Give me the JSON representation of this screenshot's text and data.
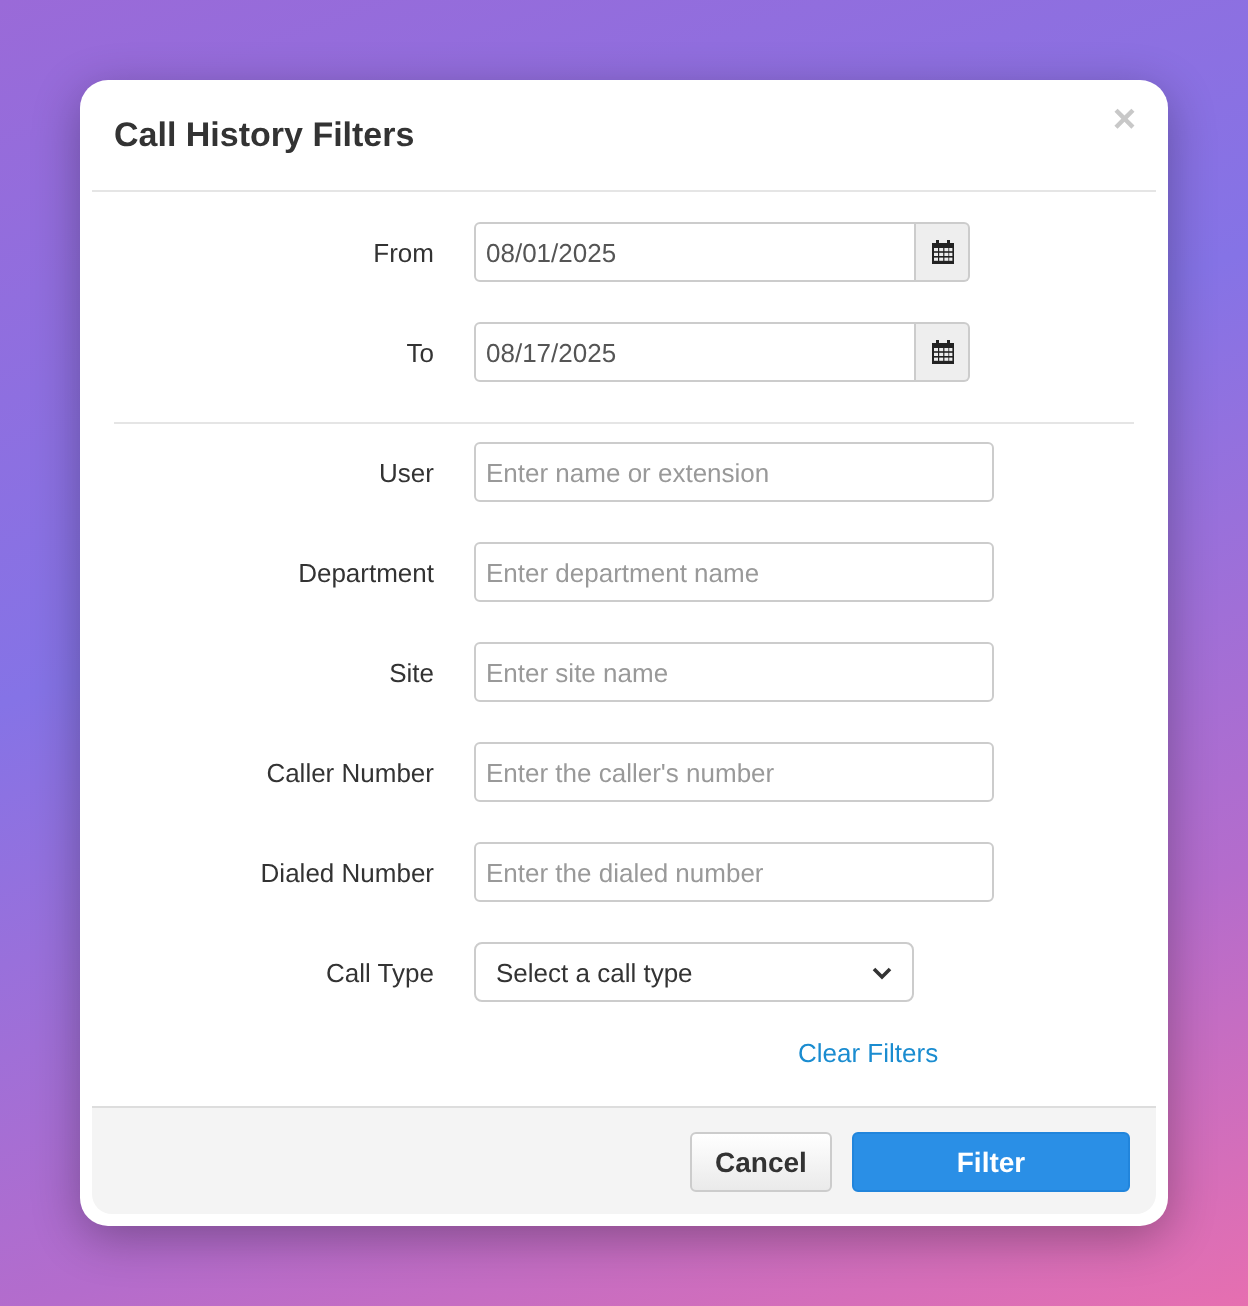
{
  "dialog": {
    "title": "Call History Filters",
    "close": "×"
  },
  "date_range": [
    {
      "label": "From",
      "kind": "date",
      "value": "08/01/2025"
    },
    {
      "label": "To",
      "kind": "date",
      "value": "08/17/2025"
    }
  ],
  "filters": [
    {
      "label": "User",
      "kind": "text",
      "placeholder": "Enter name or extension"
    },
    {
      "label": "Department",
      "kind": "text",
      "placeholder": "Enter department name"
    },
    {
      "label": "Site",
      "kind": "text",
      "placeholder": "Enter site name"
    },
    {
      "label": "Caller Number",
      "kind": "text",
      "placeholder": "Enter the caller's number"
    },
    {
      "label": "Dialed Number",
      "kind": "text",
      "placeholder": "Enter the dialed number"
    },
    {
      "label": "Call Type",
      "kind": "select",
      "value": "Select a call type"
    }
  ],
  "clear_link": "Clear Filters",
  "buttons": [
    {
      "label": "Cancel",
      "kind": "secondary"
    },
    {
      "label": "Filter",
      "kind": "primary"
    }
  ]
}
